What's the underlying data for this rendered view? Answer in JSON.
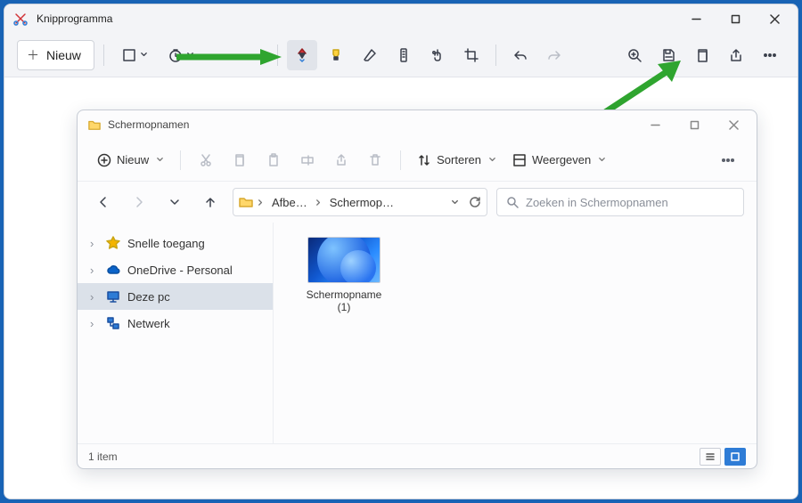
{
  "app": {
    "title": "Knipprogramma",
    "new_label": "Nieuw"
  },
  "toolbar": {
    "mode_label": "Modus",
    "delay_label": "Vertraging",
    "pen_label": "Pen",
    "highlighter_label": "Markeerstift",
    "eraser_label": "Gum",
    "ruler_label": "Liniaal",
    "touch_label": "Aanraakschrijven",
    "crop_label": "Bijsnijden",
    "undo_label": "Ongedaan maken",
    "redo_label": "Opnieuw",
    "zoom_label": "Zoom",
    "save_label": "Opslaan",
    "copy_label": "Kopiëren",
    "share_label": "Delen",
    "more_label": "Meer"
  },
  "explorer": {
    "title": "Schermopnamen",
    "new_label": "Nieuw",
    "sort_label": "Sorteren",
    "view_label": "Weergeven",
    "breadcrumb": {
      "seg1": "Afbe…",
      "seg2": "Schermop…"
    },
    "search_placeholder": "Zoeken in Schermopnamen",
    "nav": {
      "quick": "Snelle toegang",
      "onedrive": "OneDrive - Personal",
      "thispc": "Deze pc",
      "network": "Netwerk"
    },
    "file": {
      "name_line1": "Schermopname",
      "name_line2": "(1)"
    },
    "status": "1 item"
  }
}
